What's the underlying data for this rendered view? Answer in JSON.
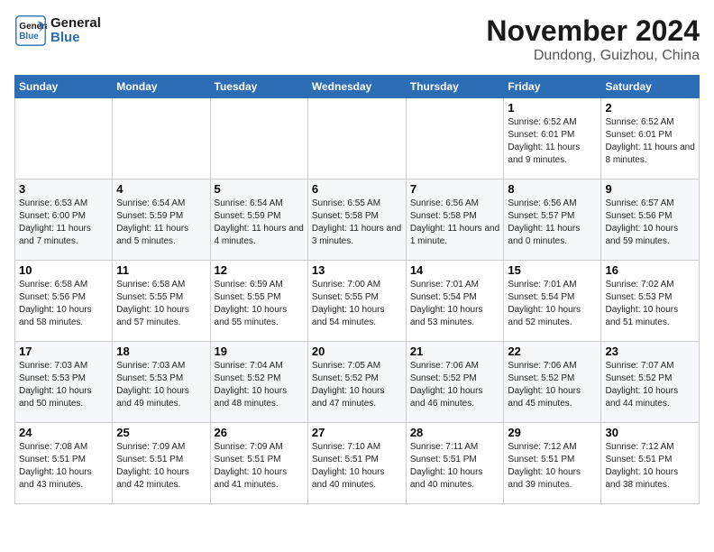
{
  "header": {
    "logo_line1": "General",
    "logo_line2": "Blue",
    "month": "November 2024",
    "location": "Dundong, Guizhou, China"
  },
  "weekdays": [
    "Sunday",
    "Monday",
    "Tuesday",
    "Wednesday",
    "Thursday",
    "Friday",
    "Saturday"
  ],
  "weeks": [
    [
      {
        "day": "",
        "info": ""
      },
      {
        "day": "",
        "info": ""
      },
      {
        "day": "",
        "info": ""
      },
      {
        "day": "",
        "info": ""
      },
      {
        "day": "",
        "info": ""
      },
      {
        "day": "1",
        "info": "Sunrise: 6:52 AM\nSunset: 6:01 PM\nDaylight: 11 hours and 9 minutes."
      },
      {
        "day": "2",
        "info": "Sunrise: 6:52 AM\nSunset: 6:01 PM\nDaylight: 11 hours and 8 minutes."
      }
    ],
    [
      {
        "day": "3",
        "info": "Sunrise: 6:53 AM\nSunset: 6:00 PM\nDaylight: 11 hours and 7 minutes."
      },
      {
        "day": "4",
        "info": "Sunrise: 6:54 AM\nSunset: 5:59 PM\nDaylight: 11 hours and 5 minutes."
      },
      {
        "day": "5",
        "info": "Sunrise: 6:54 AM\nSunset: 5:59 PM\nDaylight: 11 hours and 4 minutes."
      },
      {
        "day": "6",
        "info": "Sunrise: 6:55 AM\nSunset: 5:58 PM\nDaylight: 11 hours and 3 minutes."
      },
      {
        "day": "7",
        "info": "Sunrise: 6:56 AM\nSunset: 5:58 PM\nDaylight: 11 hours and 1 minute."
      },
      {
        "day": "8",
        "info": "Sunrise: 6:56 AM\nSunset: 5:57 PM\nDaylight: 11 hours and 0 minutes."
      },
      {
        "day": "9",
        "info": "Sunrise: 6:57 AM\nSunset: 5:56 PM\nDaylight: 10 hours and 59 minutes."
      }
    ],
    [
      {
        "day": "10",
        "info": "Sunrise: 6:58 AM\nSunset: 5:56 PM\nDaylight: 10 hours and 58 minutes."
      },
      {
        "day": "11",
        "info": "Sunrise: 6:58 AM\nSunset: 5:55 PM\nDaylight: 10 hours and 57 minutes."
      },
      {
        "day": "12",
        "info": "Sunrise: 6:59 AM\nSunset: 5:55 PM\nDaylight: 10 hours and 55 minutes."
      },
      {
        "day": "13",
        "info": "Sunrise: 7:00 AM\nSunset: 5:55 PM\nDaylight: 10 hours and 54 minutes."
      },
      {
        "day": "14",
        "info": "Sunrise: 7:01 AM\nSunset: 5:54 PM\nDaylight: 10 hours and 53 minutes."
      },
      {
        "day": "15",
        "info": "Sunrise: 7:01 AM\nSunset: 5:54 PM\nDaylight: 10 hours and 52 minutes."
      },
      {
        "day": "16",
        "info": "Sunrise: 7:02 AM\nSunset: 5:53 PM\nDaylight: 10 hours and 51 minutes."
      }
    ],
    [
      {
        "day": "17",
        "info": "Sunrise: 7:03 AM\nSunset: 5:53 PM\nDaylight: 10 hours and 50 minutes."
      },
      {
        "day": "18",
        "info": "Sunrise: 7:03 AM\nSunset: 5:53 PM\nDaylight: 10 hours and 49 minutes."
      },
      {
        "day": "19",
        "info": "Sunrise: 7:04 AM\nSunset: 5:52 PM\nDaylight: 10 hours and 48 minutes."
      },
      {
        "day": "20",
        "info": "Sunrise: 7:05 AM\nSunset: 5:52 PM\nDaylight: 10 hours and 47 minutes."
      },
      {
        "day": "21",
        "info": "Sunrise: 7:06 AM\nSunset: 5:52 PM\nDaylight: 10 hours and 46 minutes."
      },
      {
        "day": "22",
        "info": "Sunrise: 7:06 AM\nSunset: 5:52 PM\nDaylight: 10 hours and 45 minutes."
      },
      {
        "day": "23",
        "info": "Sunrise: 7:07 AM\nSunset: 5:52 PM\nDaylight: 10 hours and 44 minutes."
      }
    ],
    [
      {
        "day": "24",
        "info": "Sunrise: 7:08 AM\nSunset: 5:51 PM\nDaylight: 10 hours and 43 minutes."
      },
      {
        "day": "25",
        "info": "Sunrise: 7:09 AM\nSunset: 5:51 PM\nDaylight: 10 hours and 42 minutes."
      },
      {
        "day": "26",
        "info": "Sunrise: 7:09 AM\nSunset: 5:51 PM\nDaylight: 10 hours and 41 minutes."
      },
      {
        "day": "27",
        "info": "Sunrise: 7:10 AM\nSunset: 5:51 PM\nDaylight: 10 hours and 40 minutes."
      },
      {
        "day": "28",
        "info": "Sunrise: 7:11 AM\nSunset: 5:51 PM\nDaylight: 10 hours and 40 minutes."
      },
      {
        "day": "29",
        "info": "Sunrise: 7:12 AM\nSunset: 5:51 PM\nDaylight: 10 hours and 39 minutes."
      },
      {
        "day": "30",
        "info": "Sunrise: 7:12 AM\nSunset: 5:51 PM\nDaylight: 10 hours and 38 minutes."
      }
    ]
  ]
}
